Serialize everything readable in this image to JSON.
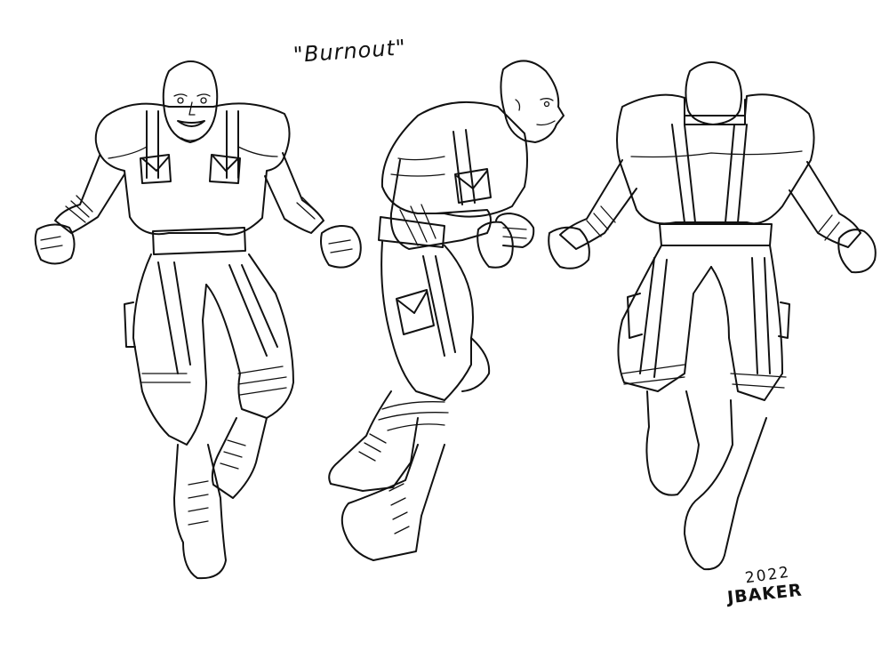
{
  "title": "\"Burnout\"",
  "signature": {
    "year": "2022",
    "name": "JBAKER"
  },
  "colors": {
    "ink": "#111111",
    "paper": "#ffffff"
  },
  "views": [
    "front",
    "side",
    "back"
  ]
}
